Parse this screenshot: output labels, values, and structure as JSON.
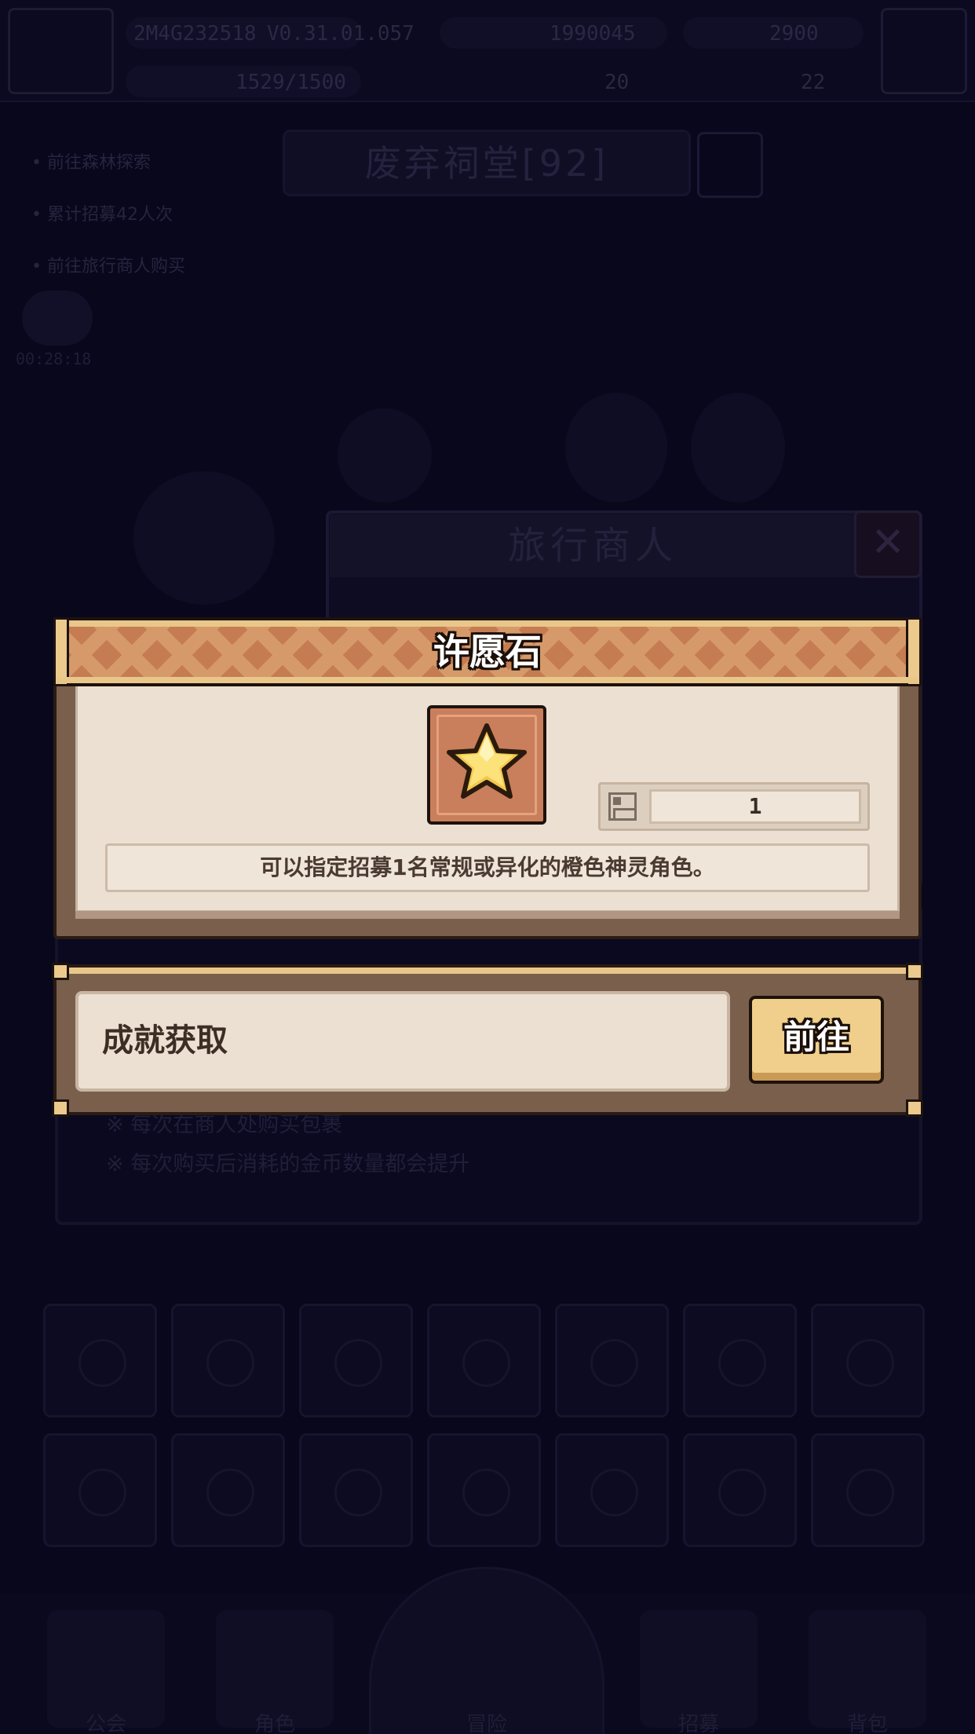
{
  "background": {
    "topbar": {
      "player_id": "2M4G232518",
      "version": "V0.31.01.057",
      "gold": "1990045",
      "gems": "2900",
      "energy": "1529/1500",
      "item_a": "20",
      "item_b": "22"
    },
    "quests": [
      "前往森林探索",
      "累计招募42人次",
      "前往旅行商人购买"
    ],
    "title_plate": "废弃祠堂[92]",
    "timer": "00:28:18",
    "merchant_title": "旅行商人",
    "shop_notes": [
      "※ 每次在商人处购买包裹",
      "※ 每次购买后消耗的金币数量都会提升"
    ],
    "nav_labels": [
      "公会",
      "角色",
      "冒险",
      "招募",
      "背包"
    ]
  },
  "item_popup": {
    "title": "许愿石",
    "icon": "gold-star-icon",
    "count_icon": "inventory-icon",
    "count": "1",
    "description": "可以指定招募1名常规或异化的橙色神灵角色。"
  },
  "source_popup": {
    "source": "成就获取",
    "go_label": "前往"
  },
  "colors": {
    "banner": "#c57c52",
    "panel": "#ece0d2",
    "frame": "#7a5f4d",
    "button": "#f0cf8c",
    "overlay": "#06051a"
  }
}
